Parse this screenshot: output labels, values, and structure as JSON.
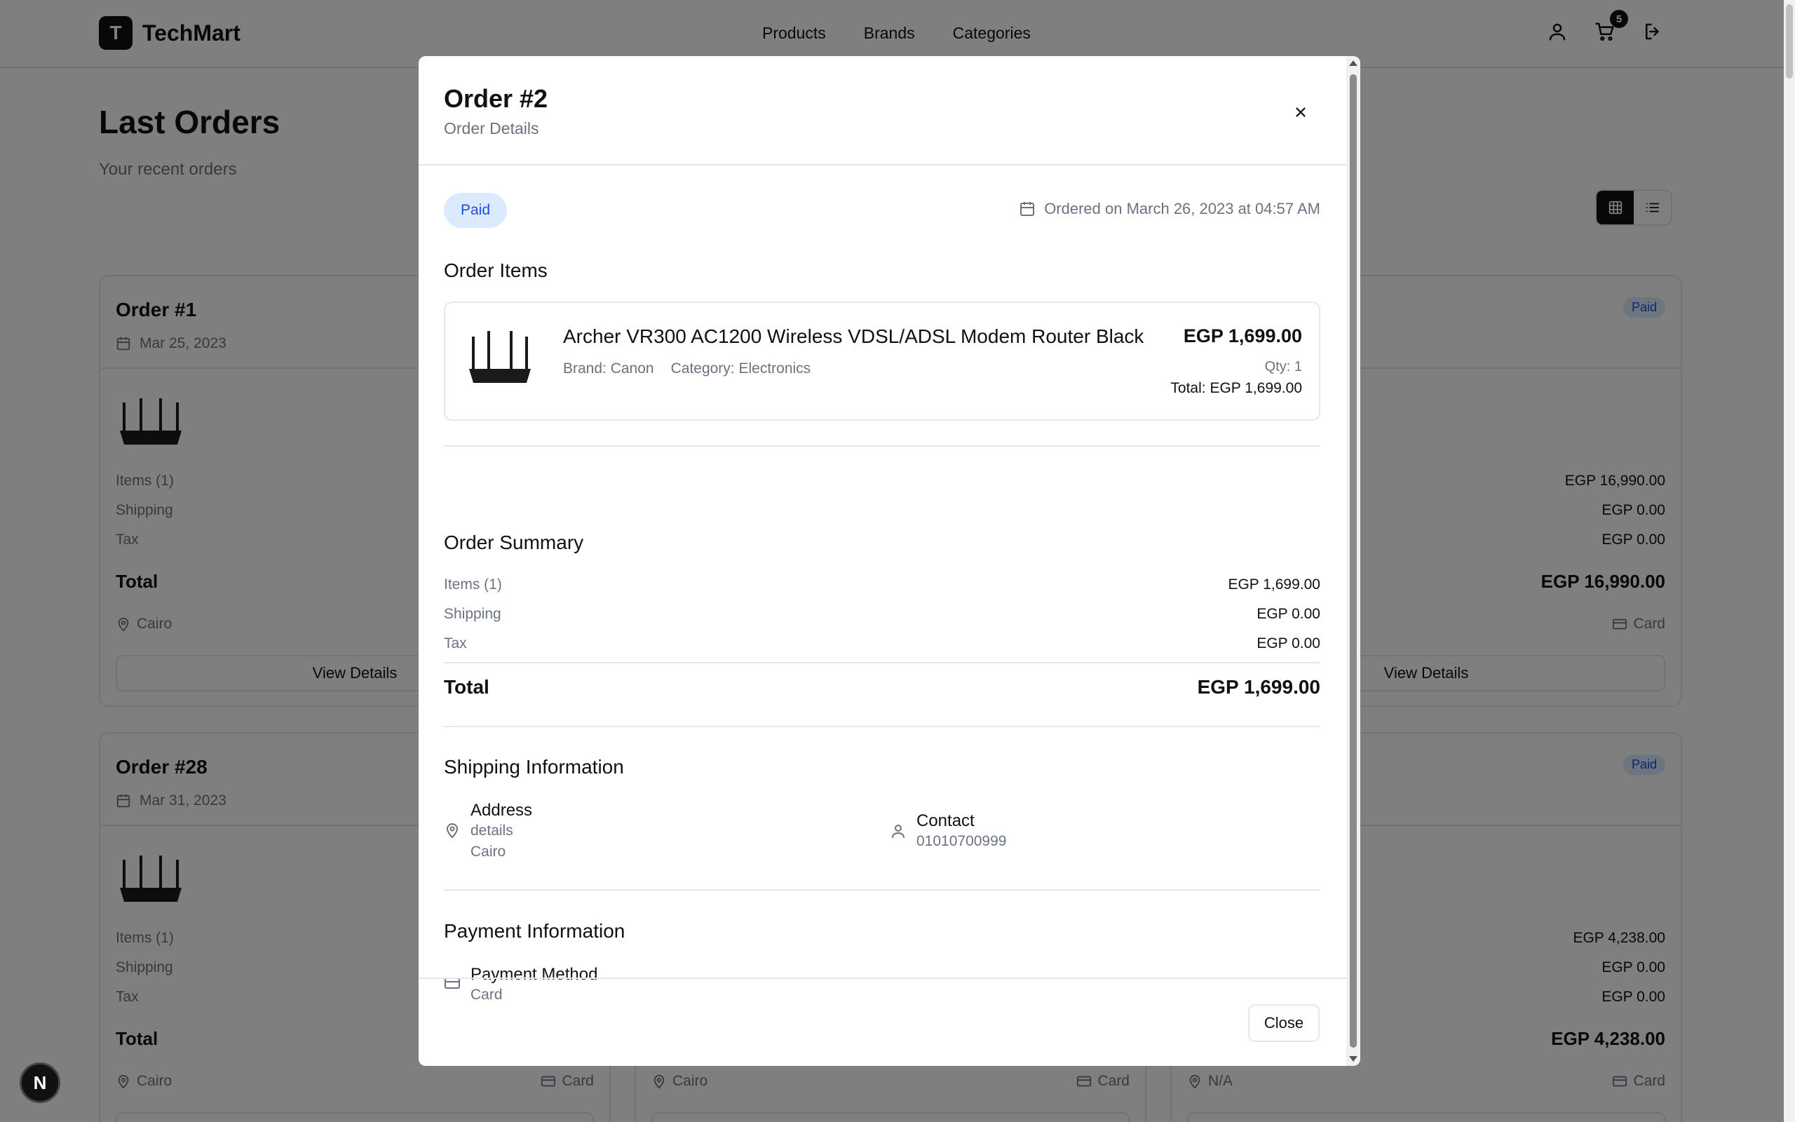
{
  "header": {
    "logo_letter": "T",
    "brand": "TechMart",
    "nav": [
      "Products",
      "Brands",
      "Categories"
    ],
    "cart_count": "5"
  },
  "page": {
    "title": "Last Orders",
    "subtitle": "Your recent orders"
  },
  "background_orders": [
    {
      "title": "Order #1",
      "date": "Mar 25, 2023",
      "items_label": "Items (1)",
      "shipping_label": "Shipping",
      "tax_label": "Tax",
      "total_label": "Total",
      "city": "Cairo",
      "button": "View Details"
    },
    {
      "status": "Paid",
      "items_value": "EGP 16,990.00",
      "shipping_value": "EGP 0.00",
      "tax_value": "EGP 0.00",
      "total_value": "EGP 16,990.00",
      "payment": "Card",
      "button": "View Details"
    },
    {
      "title": "Order #28",
      "date": "Mar 31, 2023",
      "items_label": "Items (1)",
      "shipping_label": "Shipping",
      "tax_label": "Tax",
      "total_label": "Total",
      "city": "Cairo",
      "payment": "Card"
    },
    {
      "city": "Cairo",
      "payment": "Card"
    },
    {
      "status": "Paid",
      "items_value": "EGP 4,238.00",
      "shipping_value": "EGP 0.00",
      "tax_value": "EGP 0.00",
      "total_value": "EGP 4,238.00",
      "city": "N/A",
      "payment": "Card"
    }
  ],
  "modal": {
    "title": "Order #2",
    "subtitle": "Order Details",
    "status": "Paid",
    "ordered_on": "Ordered on March 26, 2023 at 04:57 AM",
    "items_heading": "Order Items",
    "item": {
      "name": "Archer VR300 AC1200 Wireless VDSL/ADSL Modem Router Black",
      "brand": "Brand: Canon",
      "category": "Category: Electronics",
      "price": "EGP 1,699.00",
      "qty": "Qty: 1",
      "total": "Total: EGP 1,699.00"
    },
    "summary_heading": "Order Summary",
    "summary": {
      "items_label": "Items (1)",
      "items_value": "EGP 1,699.00",
      "shipping_label": "Shipping",
      "shipping_value": "EGP 0.00",
      "tax_label": "Tax",
      "tax_value": "EGP 0.00",
      "total_label": "Total",
      "total_value": "EGP 1,699.00"
    },
    "shipping_heading": "Shipping Information",
    "address_label": "Address",
    "address_details": "details",
    "address_city": "Cairo",
    "contact_label": "Contact",
    "contact_phone": "01010700999",
    "payment_heading": "Payment Information",
    "payment_method_label": "Payment Method",
    "payment_method_value": "Card",
    "close_button": "Close"
  },
  "dev_badge": "N",
  "colors": {
    "accent": "#111111",
    "paid_bg": "#dbeafe",
    "paid_text": "#1d4ed8",
    "muted": "#6b7280",
    "border": "#e5e7eb"
  }
}
